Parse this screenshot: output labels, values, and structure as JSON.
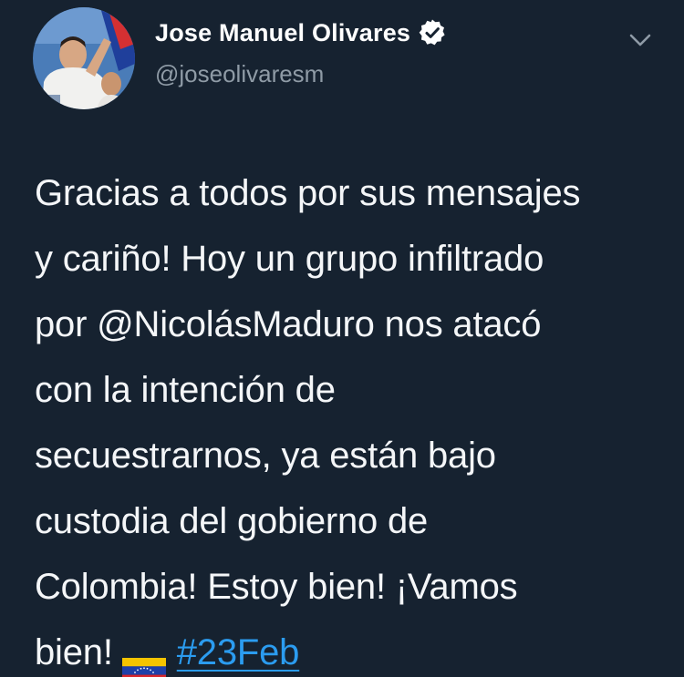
{
  "author": {
    "display_name": "Jose Manuel Olivares",
    "handle": "@joseolivaresm",
    "verified": true,
    "avatar_icon": "profile-photo-avatar"
  },
  "menu": {
    "icon": "chevron-down-icon"
  },
  "tweet": {
    "lines": [
      "Gracias a todos por sus mensajes",
      "y cariño! Hoy un grupo infiltrado",
      "por @NicolásMaduro nos atacó",
      "con la intención de",
      "secuestrarnos, ya están bajo",
      "custodia del gobierno de",
      "Colombia! Estoy bien! ¡Vamos"
    ],
    "last_line_text": "bien!",
    "emoji": "venezuela-flag-icon",
    "hashtag": "#23Feb"
  },
  "colors": {
    "background": "#162230",
    "text": "#f4f6f8",
    "secondary": "#8f9ba6",
    "link": "#2b9cf0",
    "verified_badge": "#ffffff"
  }
}
